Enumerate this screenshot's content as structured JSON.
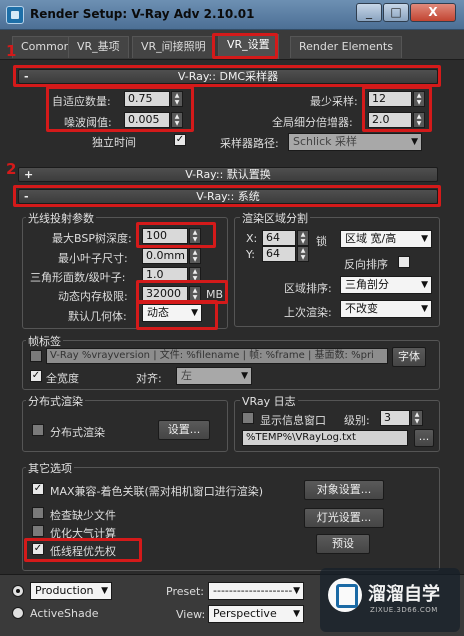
{
  "window": {
    "title": "Render Setup: V-Ray Adv 2.10.01",
    "minimize": "_",
    "restore": "□",
    "close": "X"
  },
  "tabs": [
    {
      "label": "Common"
    },
    {
      "label": "VR_基项"
    },
    {
      "label": "VR_间接照明"
    },
    {
      "label": "VR_设置"
    },
    {
      "label": "Render Elements"
    }
  ],
  "annotations": {
    "n1": "1",
    "n2": "2"
  },
  "dmc": {
    "header": "V-Ray:: DMC采样器",
    "toggle": "-",
    "adaptive_label": "自适应数量:",
    "adaptive_value": "0.75",
    "noise_label": "噪波阈值:",
    "noise_value": "0.005",
    "independent_label": "独立时间",
    "independent_check": "✓",
    "min_samples_label": "最少采样:",
    "min_samples_value": "12",
    "global_subdiv_label": "全局细分倍增器:",
    "global_subdiv_value": "2.0",
    "sampler_path_label": "采样器路径:",
    "sampler_path_value": "Schlick 采样"
  },
  "displacement": {
    "header": "V-Ray:: 默认置换",
    "toggle": "+"
  },
  "system": {
    "header": "V-Ray:: 系统",
    "toggle": "-",
    "raycast": {
      "title": "光线投射参数",
      "max_bsp_label": "最大BSP树深度:",
      "max_bsp_value": "100",
      "min_leaf_label": "最小叶子尺寸:",
      "min_leaf_value": "0.0mm",
      "face_level_label": "三角形面数/级叶子:",
      "face_level_value": "1.0",
      "mem_limit_label": "动态内存极限:",
      "mem_limit_value": "32000",
      "mem_limit_unit": "MB",
      "default_geom_label": "默认几何体:",
      "default_geom_value": "动态"
    },
    "render_region": {
      "title": "渲染区域分割",
      "x_label": "X:",
      "x_value": "64",
      "y_label": "Y:",
      "y_value": "64",
      "lock_label": "锁",
      "region_mode_value": "区域 宽/高",
      "reverse_label": "反向排序",
      "region_order_label": "区域排序:",
      "region_order_value": "三角剖分",
      "last_render_label": "上次渲染:",
      "last_render_value": "不改变"
    },
    "frame_stamp": {
      "title": "帧标签",
      "stamp_text": "V-Ray %vrayversion | 文件: %filename | 帧: %frame | 基面数: %pri",
      "font_button": "字体",
      "full_width_label": "全宽度",
      "full_width_check": "✓",
      "align_label": "对齐:",
      "align_value": "左"
    },
    "distributed": {
      "title": "分布式渲染",
      "dr_label": "分布式渲染",
      "settings_button": "设置..."
    },
    "vray_log": {
      "title": "VRay 日志",
      "show_window_label": "显示信息窗口",
      "level_label": "级别:",
      "level_value": "3",
      "log_path": "%TEMP%\\VRayLog.txt",
      "browse_button": "..."
    },
    "misc": {
      "title": "其它选项",
      "max_compat_label": "MAX兼容-着色关联(需对相机窗口进行渲染)",
      "max_compat_check": "✓",
      "check_missing_label": "检查缺少文件",
      "optimize_atm_label": "优化大气计算",
      "low_thread_label": "低线程优先权",
      "low_thread_check": "✓",
      "object_settings_button": "对象设置...",
      "light_settings_button": "灯光设置...",
      "presets_button": "预设"
    }
  },
  "bottom": {
    "production_value": "Production",
    "activeshade_label": "ActiveShade",
    "preset_label": "Preset:",
    "preset_value": "--------------------",
    "view_label": "View:",
    "view_value": "Perspective"
  },
  "watermark": {
    "brand": "溜溜自学",
    "url": "ZIXUE.3D66.COM"
  }
}
